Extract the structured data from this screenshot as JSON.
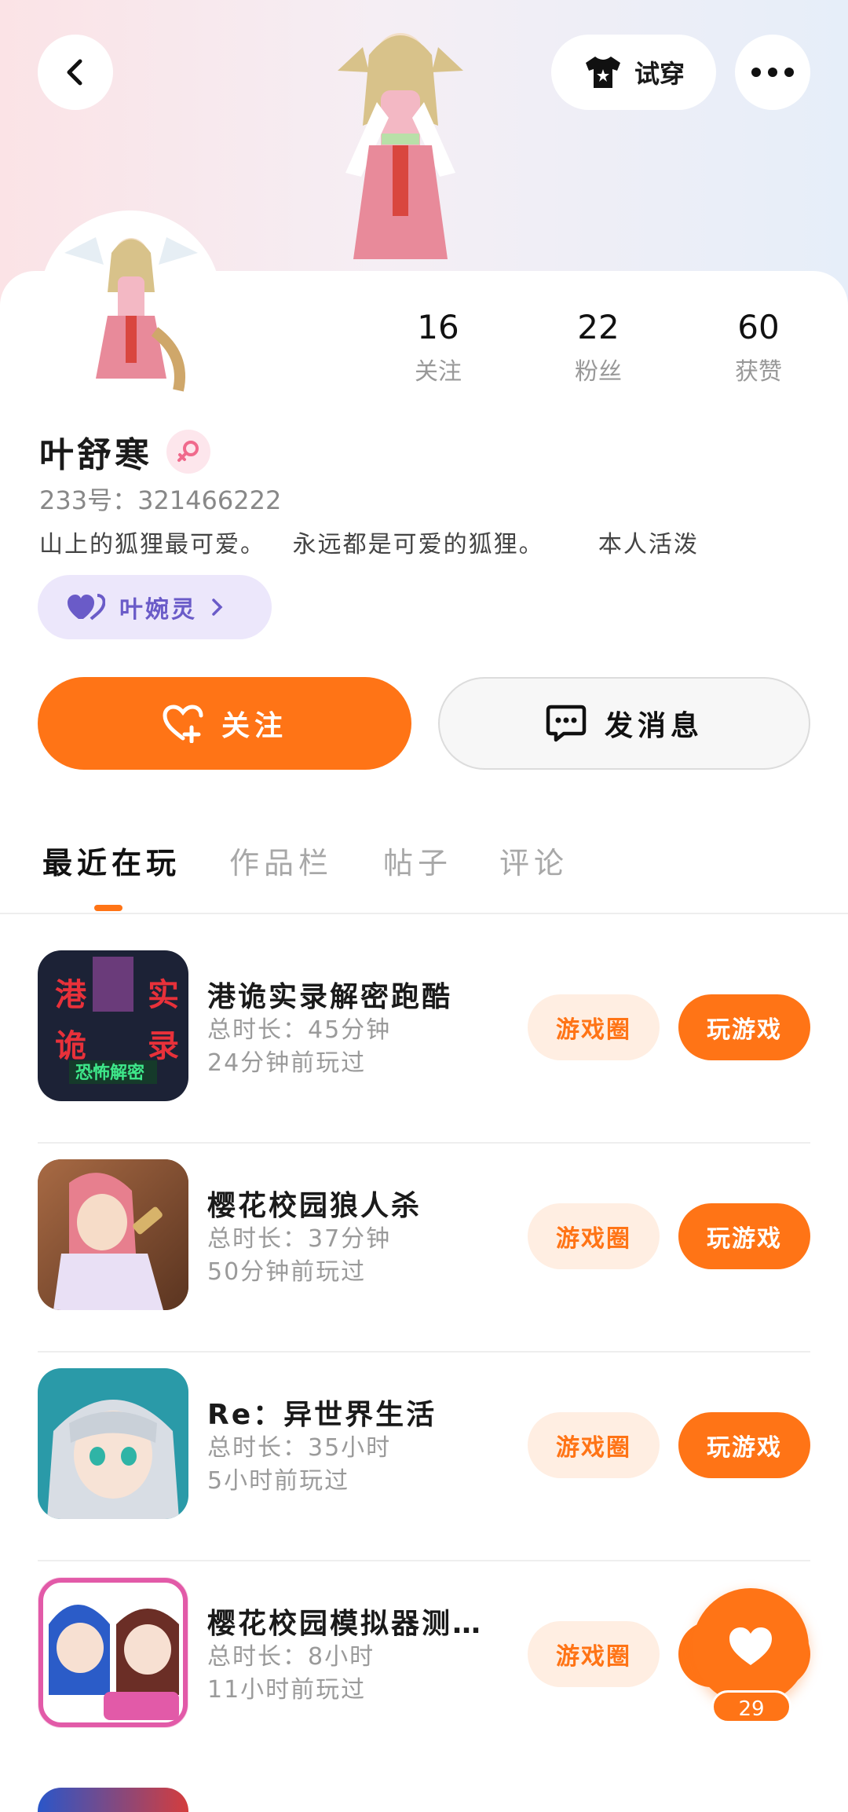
{
  "header": {
    "tryon_label": "试穿"
  },
  "profile": {
    "name": "叶舒寒",
    "uid": "233号：321466222",
    "bio": "山上的狐狸最可爱。   永远都是可爱的狐狸。      本人活泼",
    "relation_name": "叶婉灵"
  },
  "stats": [
    {
      "value": "16",
      "label": "关注"
    },
    {
      "value": "22",
      "label": "粉丝"
    },
    {
      "value": "60",
      "label": "获赞"
    }
  ],
  "actions": {
    "follow_label": "关注",
    "message_label": "发消息"
  },
  "tabs": [
    {
      "label": "最近在玩",
      "active": true
    },
    {
      "label": "作品栏",
      "active": false
    },
    {
      "label": "帖子",
      "active": false
    },
    {
      "label": "评论",
      "active": false
    }
  ],
  "games": [
    {
      "title": "港诡实录解密跑酷",
      "duration": "总时长：45分钟",
      "last_played": "24分钟前玩过",
      "circle_label": "游戏圈",
      "play_label": "玩游戏"
    },
    {
      "title": "樱花校园狼人杀",
      "duration": "总时长：37分钟",
      "last_played": "50分钟前玩过",
      "circle_label": "游戏圈",
      "play_label": "玩游戏"
    },
    {
      "title": "Re：异世界生活",
      "duration": "总时长：35小时",
      "last_played": "5小时前玩过",
      "circle_label": "游戏圈",
      "play_label": "玩游戏"
    },
    {
      "title": "樱花校园模拟器测…",
      "duration": "总时长：8小时",
      "last_played": "11小时前玩过",
      "circle_label": "游戏圈",
      "play_label": "玩游戏"
    }
  ],
  "fab": {
    "count": "29"
  },
  "colors": {
    "accent": "#ff7416",
    "accent_light": "#ffeee2",
    "relation_bg": "#ece7fb",
    "relation_text": "#6a5bc8"
  }
}
